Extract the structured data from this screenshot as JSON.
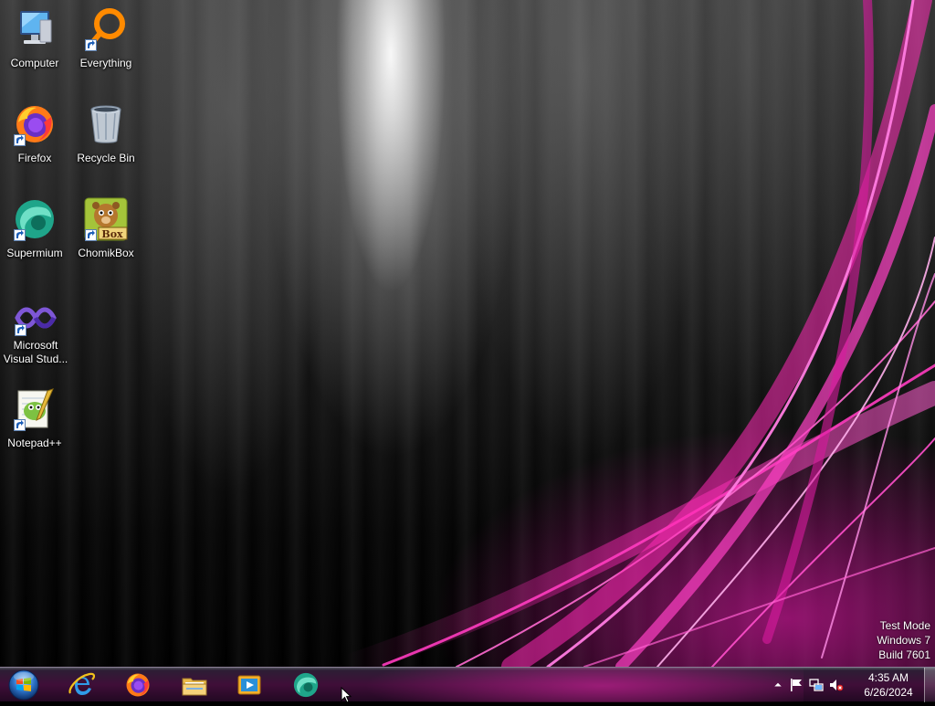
{
  "desktop": {
    "icons": [
      {
        "label": "Computer",
        "icon": "computer-icon"
      },
      {
        "label": "Everything",
        "icon": "everything-search-icon"
      },
      {
        "label": "Firefox",
        "icon": "firefox-icon"
      },
      {
        "label": "Recycle Bin",
        "icon": "recycle-bin-icon"
      },
      {
        "label": "Supermium",
        "icon": "supermium-icon"
      },
      {
        "label": "ChomikBox",
        "icon": "chomikbox-icon"
      },
      {
        "label": "Microsoft Visual Stud...",
        "icon": "visual-studio-icon"
      },
      {
        "label": "Notepad++",
        "icon": "notepad-plus-plus-icon"
      }
    ]
  },
  "watermark": {
    "line1": "Test Mode",
    "line2": "Windows 7",
    "line3": "Build 7601"
  },
  "chomikbox_badge": "Box",
  "taskbar": {
    "start": "windows-start-orb-icon",
    "pinned": [
      {
        "icon": "internet-explorer-icon"
      },
      {
        "icon": "firefox-icon"
      },
      {
        "icon": "windows-explorer-icon"
      },
      {
        "icon": "media-player-icon"
      },
      {
        "icon": "supermium-icon"
      }
    ],
    "tray": [
      "show-hidden-icons-arrow-icon",
      "action-center-flag-icon",
      "network-icon",
      "volume-muted-icon"
    ],
    "clock": {
      "time": "4:35 AM",
      "date": "6/26/2024"
    }
  },
  "colors": {
    "accent": "#e0209c",
    "taskbar_text": "#ffffff"
  }
}
